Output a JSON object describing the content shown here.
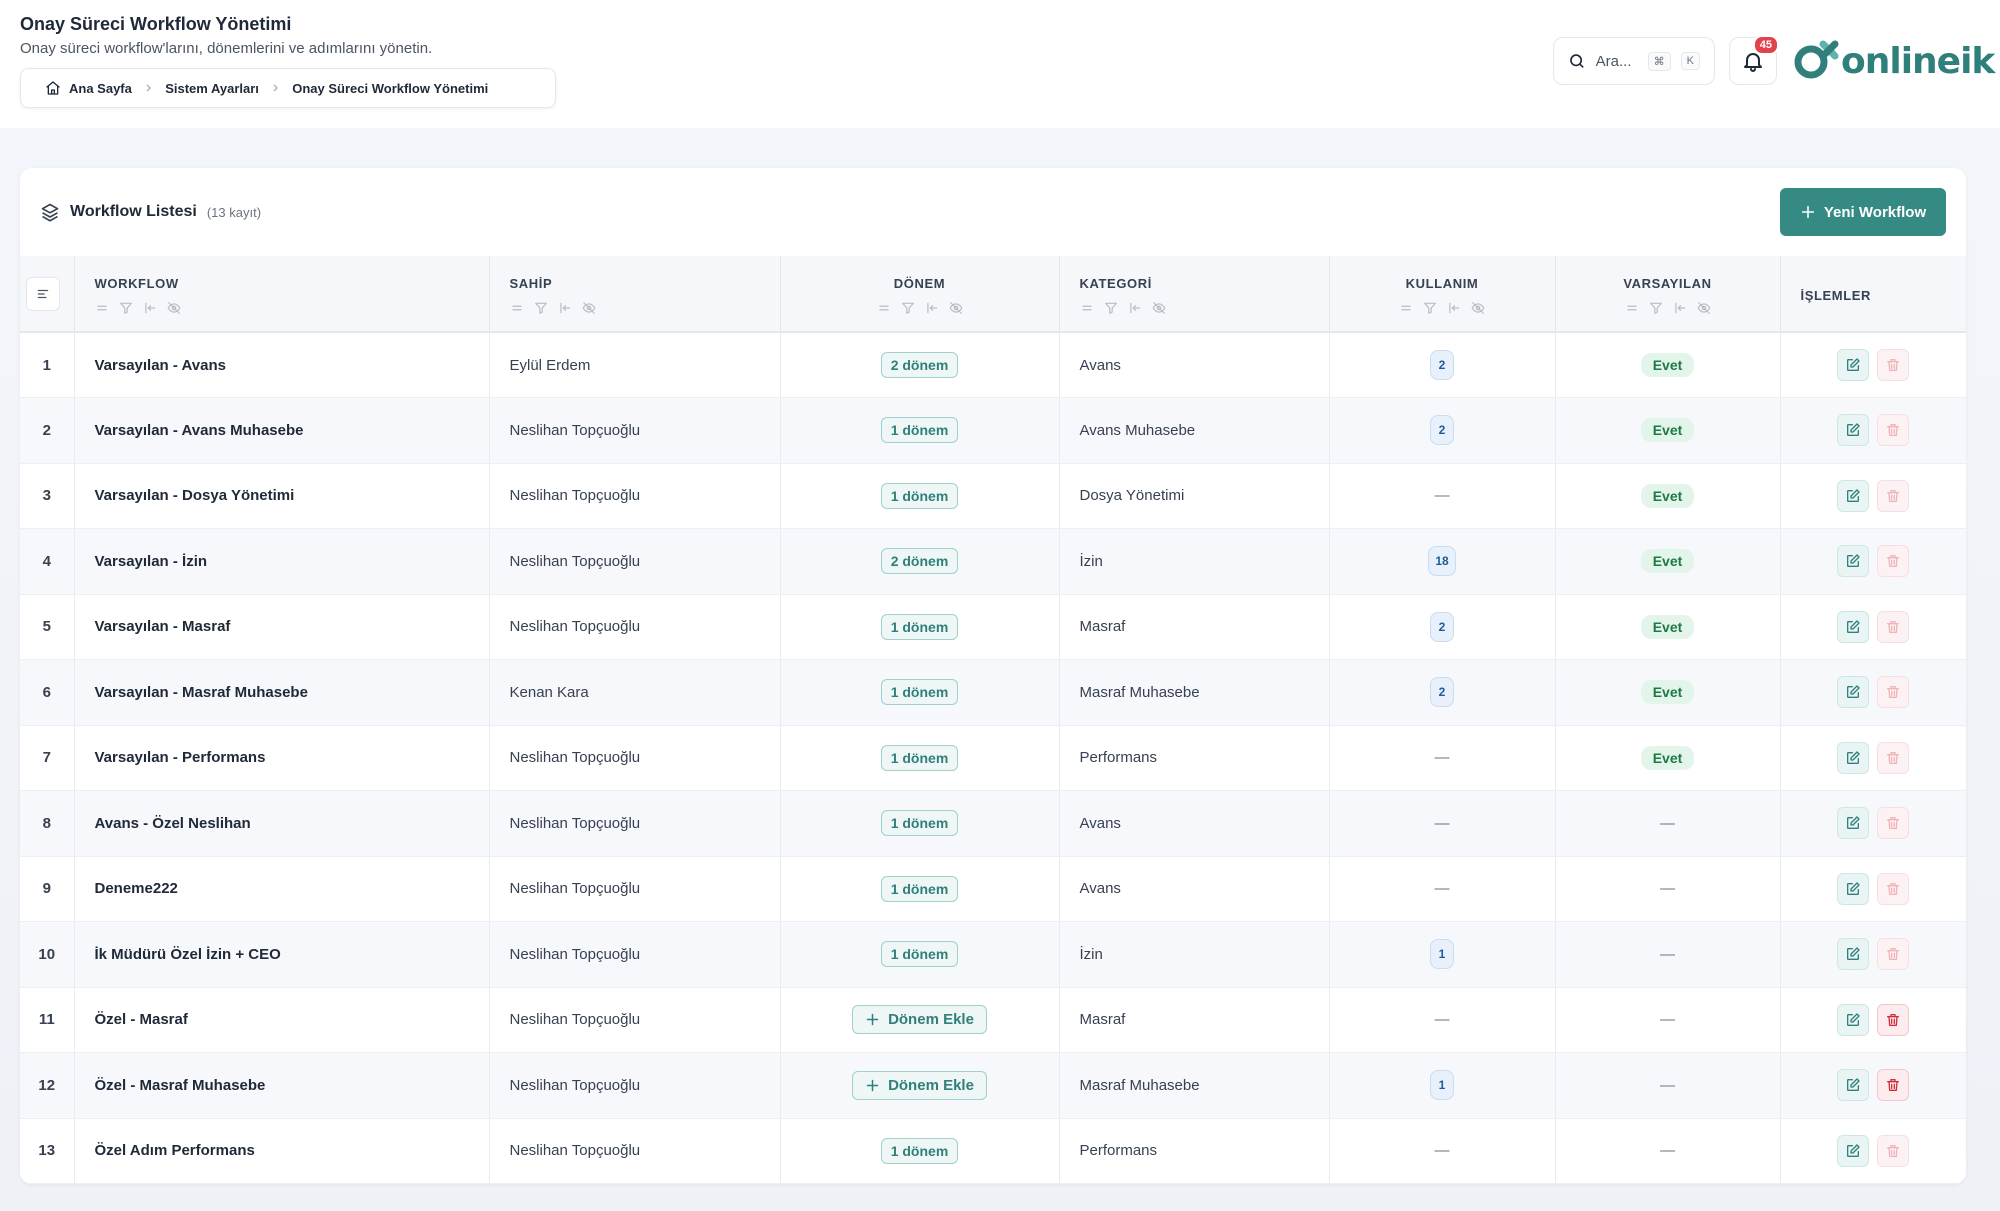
{
  "header": {
    "title": "Onay Süreci Workflow Yönetimi",
    "subtitle": "Onay süreci workflow'larını, dönemlerini ve adımlarını yönetin.",
    "breadcrumb": [
      "Ana Sayfa",
      "Sistem Ayarları",
      "Onay Süreci Workflow Yönetimi"
    ],
    "search_placeholder": "Ara...",
    "search_kbd_cmd": "⌘",
    "search_kbd_key": "K",
    "notification_count": "45",
    "logo_text": "onlineik"
  },
  "card": {
    "title": "Workflow Listesi",
    "count": "(13 kayıt)",
    "new_button": "Yeni Workflow"
  },
  "columns": {
    "workflow": "WORKFLOW",
    "owner": "SAHİP",
    "period": "DÖNEM",
    "category": "KATEGORİ",
    "usage": "KULLANIM",
    "default": "VARSAYILAN",
    "actions": "İŞLEMLER"
  },
  "add_period_label": "Dönem Ekle",
  "dash": "—",
  "colors": {
    "accent": "#358a84",
    "danger": "#e2434b"
  },
  "rows": [
    {
      "n": "1",
      "name": "Varsayılan - Avans",
      "owner": "Eylül Erdem",
      "period": "2 dönem",
      "category": "Avans",
      "usage": "2",
      "default": "Evet",
      "delete_enabled": false
    },
    {
      "n": "2",
      "name": "Varsayılan - Avans Muhasebe",
      "owner": "Neslihan Topçuoğlu",
      "period": "1 dönem",
      "category": "Avans Muhasebe",
      "usage": "2",
      "default": "Evet",
      "delete_enabled": false
    },
    {
      "n": "3",
      "name": "Varsayılan - Dosya Yönetimi",
      "owner": "Neslihan Topçuoğlu",
      "period": "1 dönem",
      "category": "Dosya Yönetimi",
      "usage": "",
      "default": "Evet",
      "delete_enabled": false
    },
    {
      "n": "4",
      "name": "Varsayılan - İzin",
      "owner": "Neslihan Topçuoğlu",
      "period": "2 dönem",
      "category": "İzin",
      "usage": "18",
      "default": "Evet",
      "delete_enabled": false
    },
    {
      "n": "5",
      "name": "Varsayılan - Masraf",
      "owner": "Neslihan Topçuoğlu",
      "period": "1 dönem",
      "category": "Masraf",
      "usage": "2",
      "default": "Evet",
      "delete_enabled": false
    },
    {
      "n": "6",
      "name": "Varsayılan - Masraf Muhasebe",
      "owner": "Kenan Kara",
      "period": "1 dönem",
      "category": "Masraf Muhasebe",
      "usage": "2",
      "default": "Evet",
      "delete_enabled": false
    },
    {
      "n": "7",
      "name": "Varsayılan - Performans",
      "owner": "Neslihan Topçuoğlu",
      "period": "1 dönem",
      "category": "Performans",
      "usage": "",
      "default": "Evet",
      "delete_enabled": false
    },
    {
      "n": "8",
      "name": "Avans - Özel Neslihan",
      "owner": "Neslihan Topçuoğlu",
      "period": "1 dönem",
      "category": "Avans",
      "usage": "",
      "default": "",
      "delete_enabled": false
    },
    {
      "n": "9",
      "name": "Deneme222",
      "owner": "Neslihan Topçuoğlu",
      "period": "1 dönem",
      "category": "Avans",
      "usage": "",
      "default": "",
      "delete_enabled": false
    },
    {
      "n": "10",
      "name": "İk Müdürü Özel İzin + CEO",
      "owner": "Neslihan Topçuoğlu",
      "period": "1 dönem",
      "category": "İzin",
      "usage": "1",
      "default": "",
      "delete_enabled": false
    },
    {
      "n": "11",
      "name": "Özel - Masraf",
      "owner": "Neslihan Topçuoğlu",
      "period": "",
      "category": "Masraf",
      "usage": "",
      "default": "",
      "delete_enabled": true
    },
    {
      "n": "12",
      "name": "Özel - Masraf Muhasebe",
      "owner": "Neslihan Topçuoğlu",
      "period": "",
      "category": "Masraf Muhasebe",
      "usage": "1",
      "default": "",
      "delete_enabled": true
    },
    {
      "n": "13",
      "name": "Özel Adım Performans",
      "owner": "Neslihan Topçuoğlu",
      "period": "1 dönem",
      "category": "Performans",
      "usage": "",
      "default": "",
      "delete_enabled": false
    }
  ]
}
